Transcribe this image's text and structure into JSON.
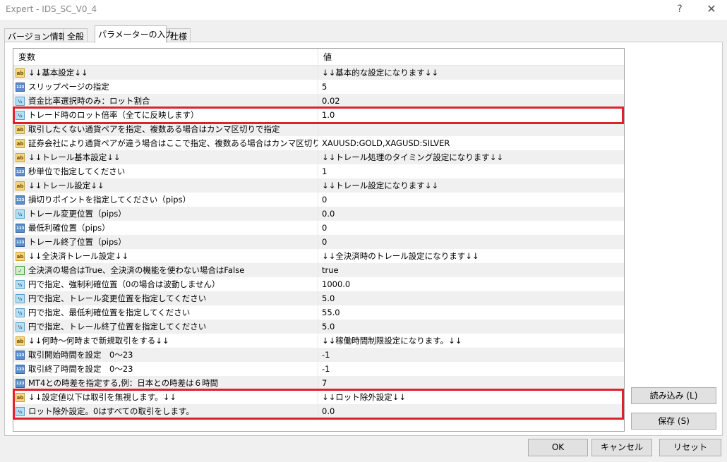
{
  "window": {
    "title": "Expert - IDS_SC_V0_4",
    "help": "?",
    "close": "✕"
  },
  "tabs": [
    "バージョン情報",
    "全般",
    "パラメーターの入力",
    "仕様"
  ],
  "grid": {
    "headers": {
      "variable": "変数",
      "value": "値"
    },
    "rows": [
      {
        "icon": "ab",
        "name": "↓↓基本設定↓↓",
        "value": "↓↓基本的な設定になります↓↓"
      },
      {
        "icon": "123",
        "name": "スリップページの指定",
        "value": "5"
      },
      {
        "icon": "frac",
        "name": "資金比率選択時のみ：ロット割合",
        "value": "0.02"
      },
      {
        "icon": "frac",
        "name": "トレード時のロット倍率（全てに反映します）",
        "value": "1.0"
      },
      {
        "icon": "ab",
        "name": "取引したくない通貨ペアを指定、複数ある場合はカンマ区切りで指定",
        "value": ""
      },
      {
        "icon": "ab",
        "name": "証券会社により通貨ペアが違う場合はここで指定、複数ある場合はカンマ区切りで･･",
        "value": "XAUUSD:GOLD,XAGUSD:SILVER"
      },
      {
        "icon": "ab",
        "name": "↓↓トレール基本設定↓↓",
        "value": "↓↓トレール処理のタイミング設定になります↓↓"
      },
      {
        "icon": "123",
        "name": "秒単位で指定してください",
        "value": "1"
      },
      {
        "icon": "ab",
        "name": "↓↓トレール設定↓↓",
        "value": "↓↓トレール設定になります↓↓"
      },
      {
        "icon": "123",
        "name": "損切りポイントを指定してください（pips）",
        "value": "0"
      },
      {
        "icon": "frac",
        "name": "トレール変更位置（pips）",
        "value": "0.0"
      },
      {
        "icon": "123",
        "name": "最低利確位置（pips）",
        "value": "0"
      },
      {
        "icon": "123",
        "name": "トレール終了位置（pips）",
        "value": "0"
      },
      {
        "icon": "ab",
        "name": "↓↓全決済トレール設定↓↓",
        "value": "↓↓全決済時のトレール設定になります↓↓"
      },
      {
        "icon": "bool",
        "name": "全決済の場合はTrue、全決済の機能を使わない場合はFalse",
        "value": "true"
      },
      {
        "icon": "frac",
        "name": "円で指定、強制利確位置（0の場合は波動しません）",
        "value": "1000.0"
      },
      {
        "icon": "frac",
        "name": "円で指定、トレール変更位置を指定してください",
        "value": "5.0"
      },
      {
        "icon": "frac",
        "name": "円で指定、最低利確位置を指定してください",
        "value": "55.0"
      },
      {
        "icon": "frac",
        "name": "円で指定、トレール終了位置を指定してください",
        "value": "5.0"
      },
      {
        "icon": "ab",
        "name": "↓↓何時～何時まで新規取引をする↓↓",
        "value": "↓↓稼働時間制限設定になります。↓↓"
      },
      {
        "icon": "123",
        "name": "取引開始時間を設定　0～23",
        "value": "-1"
      },
      {
        "icon": "123",
        "name": "取引終了時間を設定　0～23",
        "value": "-1"
      },
      {
        "icon": "123",
        "name": "MT4との時差を指定する,例：日本との時差は６時間",
        "value": "7"
      },
      {
        "icon": "ab",
        "name": "↓↓設定値以下は取引を無視します。↓↓",
        "value": "↓↓ロット除外設定↓↓"
      },
      {
        "icon": "frac",
        "name": "ロット除外設定。0はすべての取引をします。",
        "value": "0.0"
      }
    ]
  },
  "icon_text": {
    "ab": "ab",
    "123": "123",
    "frac": "½",
    "bool": "✓"
  },
  "buttons": {
    "load": "読み込み (L)",
    "save": "保存 (S)",
    "ok": "OK",
    "cancel": "キャンセル",
    "reset": "リセット"
  },
  "colors": {
    "highlight": "#e0202a",
    "alt_row": "#f0f0f0"
  }
}
